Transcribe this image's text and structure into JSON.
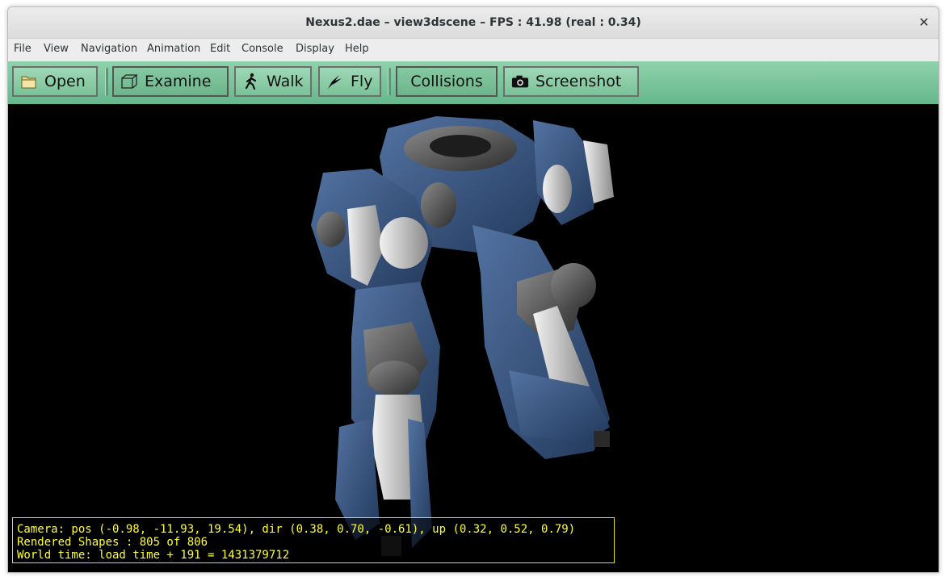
{
  "window": {
    "title": "Nexus2.dae – view3dscene – FPS : 41.98 (real : 0.34)",
    "close_label": "✕"
  },
  "menubar": {
    "items": [
      "File",
      "View",
      "Navigation",
      "Animation",
      "Edit",
      "Console",
      "Display",
      "Help"
    ]
  },
  "toolbar": {
    "open_label": "Open",
    "examine_label": "Examine",
    "walk_label": "Walk",
    "fly_label": "Fly",
    "collisions_label": "Collisions",
    "screenshot_label": "Screenshot",
    "pressed": [
      "Examine",
      "Collisions"
    ],
    "icons": [
      "folder-icon",
      "cube-icon",
      "walker-icon",
      "bird-icon",
      "camera-icon"
    ]
  },
  "viewport": {
    "background": "#000000",
    "model_colors": [
      "#3a5a85",
      "#c9c9c9",
      "#4a4a4a"
    ],
    "status_color": "#ffff33"
  },
  "status": {
    "camera": "Camera: pos (-0.98, -11.93, 19.54), dir (0.38, 0.70, -0.61), up (0.32, 0.52, 0.79)",
    "shapes": "Rendered Shapes : 805 of 806",
    "world_time": "World time: load time + 191 = 1431379712"
  }
}
